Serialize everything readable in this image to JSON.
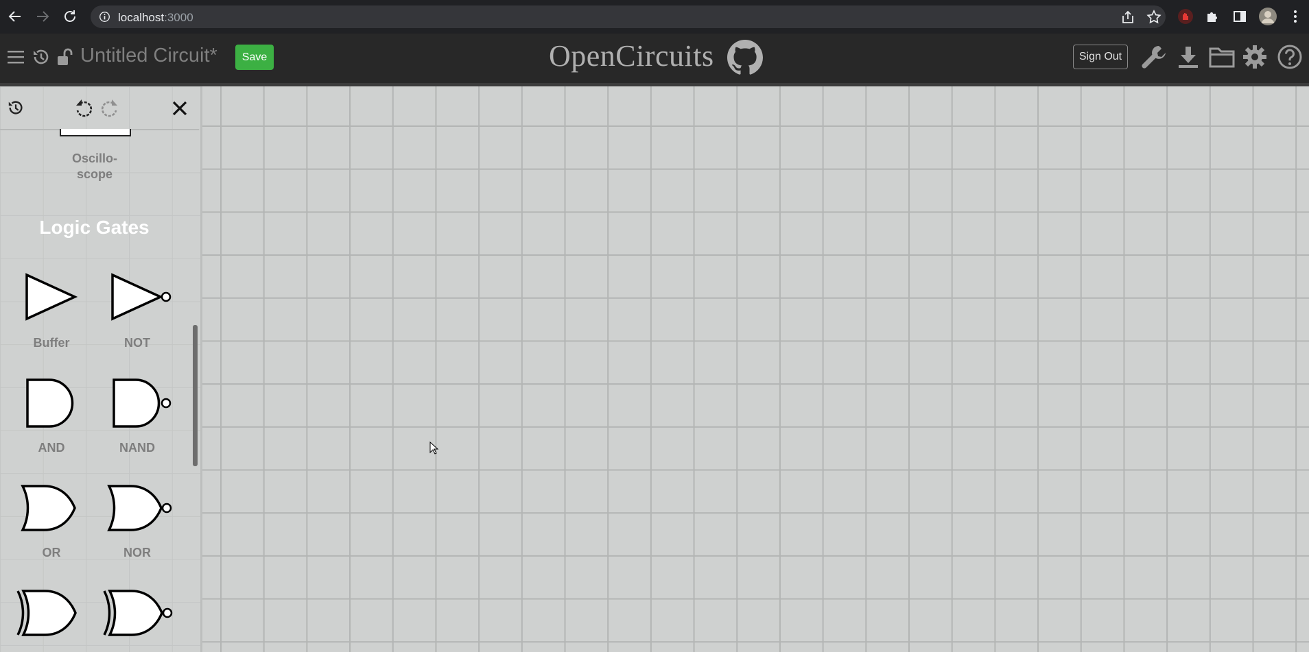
{
  "browser": {
    "url_host": "localhost",
    "url_port": ":3000"
  },
  "header": {
    "circuit_name": "Untitled Circuit*",
    "save_label": "Save",
    "brand": "OpenCircuits",
    "sign_out_label": "Sign Out"
  },
  "sidebar": {
    "previous_item_label": "Oscillo-",
    "previous_item_label_2": "scope",
    "section_title": "Logic Gates",
    "gates": [
      {
        "label": "Buffer",
        "icon": "buffer-gate-icon"
      },
      {
        "label": "NOT",
        "icon": "not-gate-icon"
      },
      {
        "label": "AND",
        "icon": "and-gate-icon"
      },
      {
        "label": "NAND",
        "icon": "nand-gate-icon"
      },
      {
        "label": "OR",
        "icon": "or-gate-icon"
      },
      {
        "label": "NOR",
        "icon": "nor-gate-icon"
      },
      {
        "label": "",
        "icon": "xor-gate-icon"
      },
      {
        "label": "",
        "icon": "xnor-gate-icon"
      }
    ]
  },
  "colors": {
    "save_button": "#3cb043",
    "header_bg": "#282828",
    "canvas_bg": "#cfd1d0",
    "grid_line": "#b3b5b4"
  }
}
